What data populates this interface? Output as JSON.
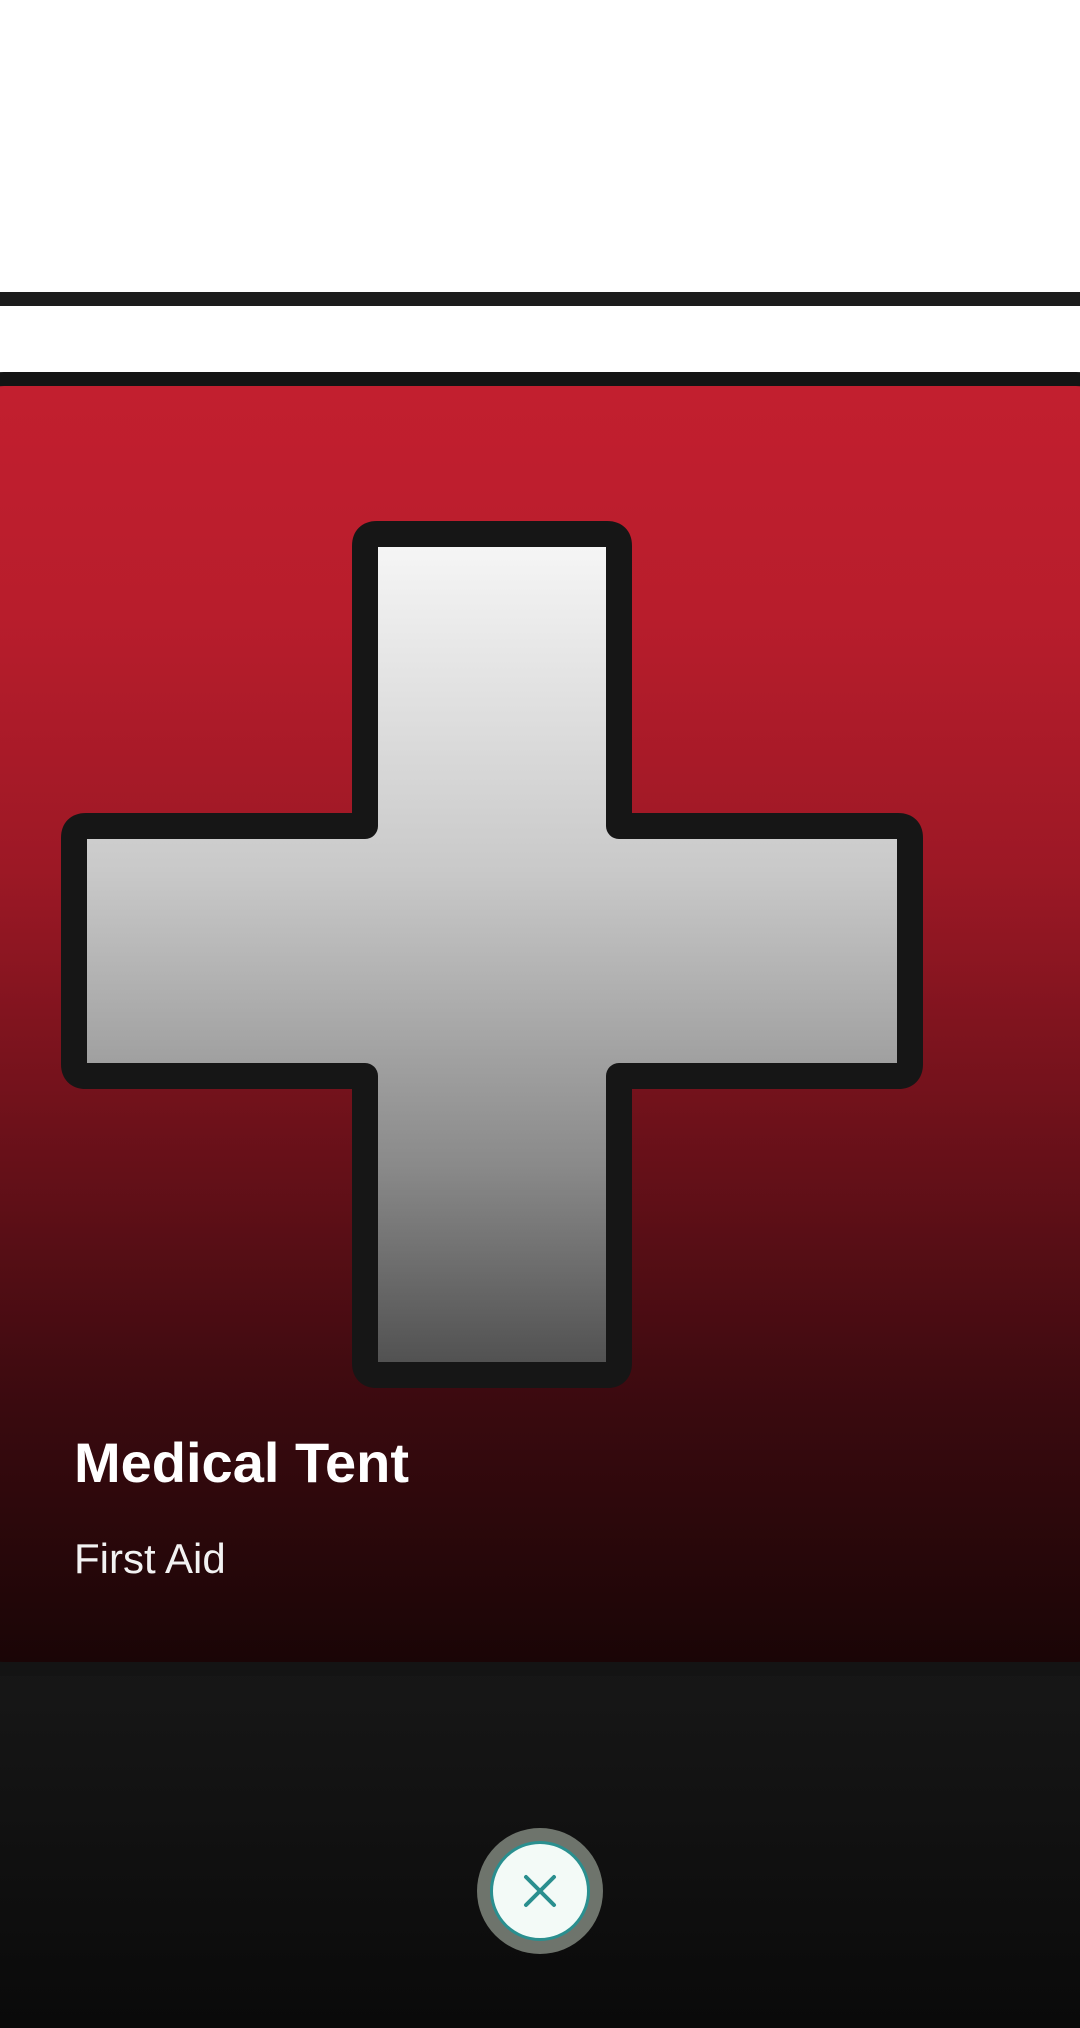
{
  "card": {
    "title": "Medical Tent",
    "subtitle": "First Aid",
    "icon": "medical-cross-icon",
    "colors": {
      "card_top": "#c21f2f",
      "card_bottom": "#1a0506",
      "outline": "#141414",
      "cross_light": "#f7f7f7",
      "cross_dark": "#4e4e4e"
    }
  },
  "controls": {
    "close_icon": "close-icon",
    "colors": {
      "ring": "#6e746c",
      "fill": "#f3faf7",
      "accent": "#2a8f8f"
    }
  }
}
